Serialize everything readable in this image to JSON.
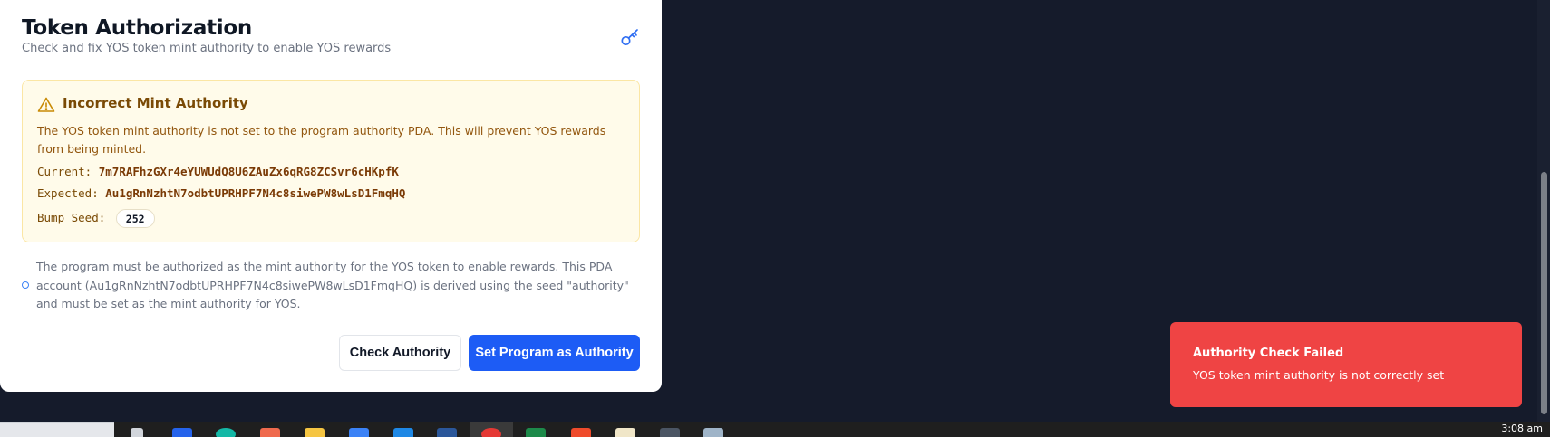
{
  "card": {
    "title": "Token Authorization",
    "subtitle": "Check and fix YOS token mint authority to enable YOS rewards"
  },
  "warning": {
    "title": "Incorrect Mint Authority",
    "description": "The YOS token mint authority is not set to the program authority PDA. This will prevent YOS rewards from being minted.",
    "current_label": "Current:",
    "current_value": "7m7RAFhzGXr4eYUWUdQ8U6ZAuZx6qRG8ZCSvr6cHKpfK",
    "expected_label": "Expected:",
    "expected_value": "Au1gRnNzhtN7odbtUPRHPF7N4c8siwePW8wLsD1FmqHQ",
    "bump_label": "Bump Seed:",
    "bump_value": "252"
  },
  "info": {
    "text": "The program must be authorized as the mint authority for the YOS token to enable rewards. This PDA account (Au1gRnNzhtN7odbtUPRHPF7N4c8siwePW8wLsD1FmqHQ) is derived using the seed \"authority\" and must be set as the mint authority for YOS."
  },
  "buttons": {
    "check_label": "Check Authority",
    "set_label": "Set Program as Authority"
  },
  "toast": {
    "title": "Authority Check Failed",
    "message": "YOS token mint authority is not correctly set"
  },
  "taskbar": {
    "clock": "3:08 am"
  },
  "colors": {
    "primary": "#1d5cf5",
    "toast_bg": "#ef4444",
    "warning_bg": "#fffbea",
    "warning_text": "#92560e",
    "page_bg": "#151b2b"
  }
}
